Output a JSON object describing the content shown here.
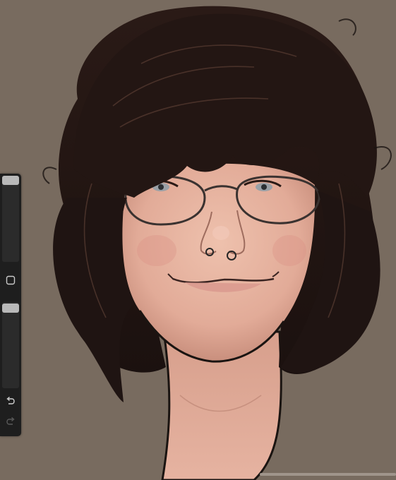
{
  "app": {
    "canvas_background": "#786b5f",
    "sidebar_color": "#1e1e1e"
  },
  "sidebar": {
    "brush_size_slider": {
      "value_fraction": 0.0
    },
    "opacity_slider": {
      "value_fraction": 0.0
    },
    "modifier_icon": "square-icon",
    "undo_icon": "undo-icon",
    "redo_icon": "redo-icon",
    "redo_enabled": false
  }
}
